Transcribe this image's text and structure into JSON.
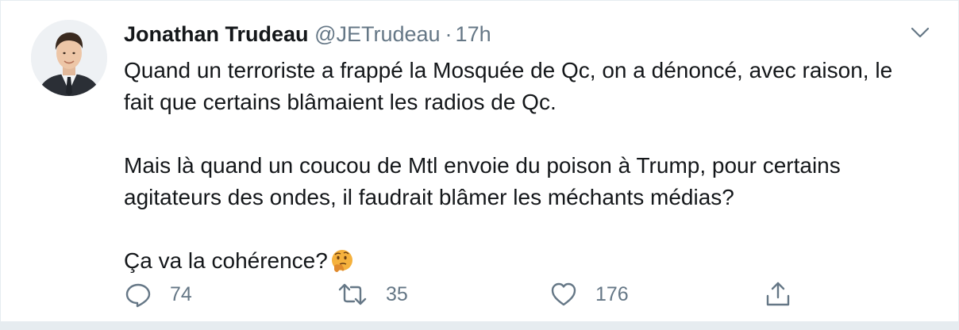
{
  "tweet": {
    "display_name": "Jonathan Trudeau",
    "handle": "@JETrudeau",
    "separator": "·",
    "time": "17h",
    "paragraphs": [
      "Quand un terroriste a frappé la Mosquée de Qc, on a dénoncé, avec raison, le fait que certains blâmaient les radios de Qc.",
      "Mais là quand un coucou de Mtl envoie du poison à Trump, pour certains agitateurs des ondes, il faudrait blâmer les méchants médias?",
      "Ça va la cohérence?"
    ],
    "emoji": "thinking-face"
  },
  "actions": {
    "reply_count": "74",
    "retweet_count": "35",
    "like_count": "176"
  },
  "icons": {
    "reply": "speech-bubble-icon",
    "retweet": "retweet-arrows-icon",
    "like": "heart-icon",
    "share": "share-upload-icon",
    "menu": "chevron-down-icon"
  },
  "colors": {
    "text_primary": "#14171a",
    "text_secondary": "#657786",
    "border": "#e6ecf0",
    "emoji_face": "#f5b13d"
  }
}
